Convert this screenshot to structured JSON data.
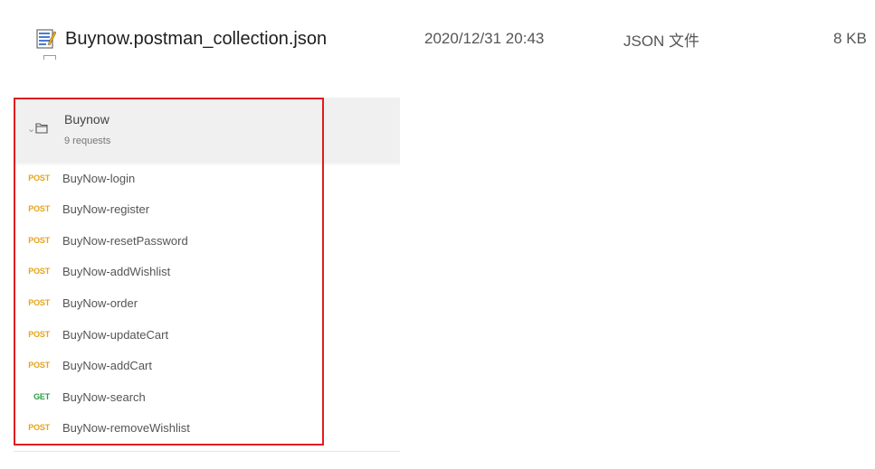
{
  "file": {
    "name": "Buynow.postman_collection.json",
    "date": "2020/12/31 20:43",
    "type": "JSON 文件",
    "size": "8 KB",
    "icon": "json-file-icon"
  },
  "collection": {
    "title": "Buynow",
    "subtitle": "9 requests",
    "requests": [
      {
        "method": "POST",
        "name": "BuyNow-login"
      },
      {
        "method": "POST",
        "name": "BuyNow-register"
      },
      {
        "method": "POST",
        "name": "BuyNow-resetPassword"
      },
      {
        "method": "POST",
        "name": "BuyNow-addWishlist"
      },
      {
        "method": "POST",
        "name": "BuyNow-order"
      },
      {
        "method": "POST",
        "name": "BuyNow-updateCart"
      },
      {
        "method": "POST",
        "name": "BuyNow-addCart"
      },
      {
        "method": "GET",
        "name": "BuyNow-search"
      },
      {
        "method": "POST",
        "name": "BuyNow-removeWishlist"
      }
    ]
  },
  "colors": {
    "post": "#e8a318",
    "get": "#2b9a43",
    "highlight_border": "#e11d1d"
  }
}
